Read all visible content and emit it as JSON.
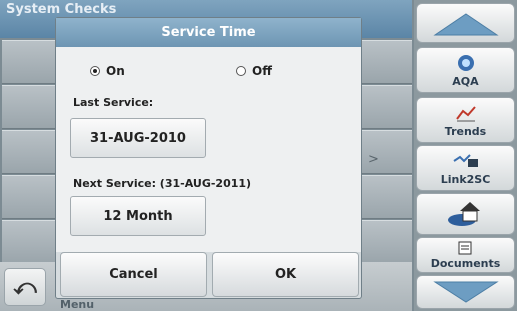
{
  "background": {
    "header_title": "System Checks",
    "menu_label": "Menu",
    "row_glyph": ">"
  },
  "dialog": {
    "title": "Service Time",
    "radio_on": "On",
    "radio_off": "Off",
    "selected": "On",
    "last_service_label": "Last Service:",
    "last_service_value": "31-AUG-2010",
    "next_service_label": "Next Service: (31-AUG-2011)",
    "next_service_value": "12 Month",
    "cancel_label": "Cancel",
    "ok_label": "OK"
  },
  "sidebar": {
    "items": [
      {
        "label": "",
        "icon": "arrow-up-icon"
      },
      {
        "label": "AQA",
        "icon": "aqa-icon"
      },
      {
        "label": "Trends",
        "icon": "trends-icon"
      },
      {
        "label": "Link2SC",
        "icon": "link2sc-icon"
      },
      {
        "label": "",
        "icon": "home-icon"
      },
      {
        "label": "Documents",
        "icon": "documents-icon"
      },
      {
        "label": "",
        "icon": "arrow-down-icon"
      }
    ]
  },
  "colors": {
    "title_bar": "#7fa4bf",
    "dialog_bg": "#eef0f1",
    "accent": "#5b85a6"
  }
}
